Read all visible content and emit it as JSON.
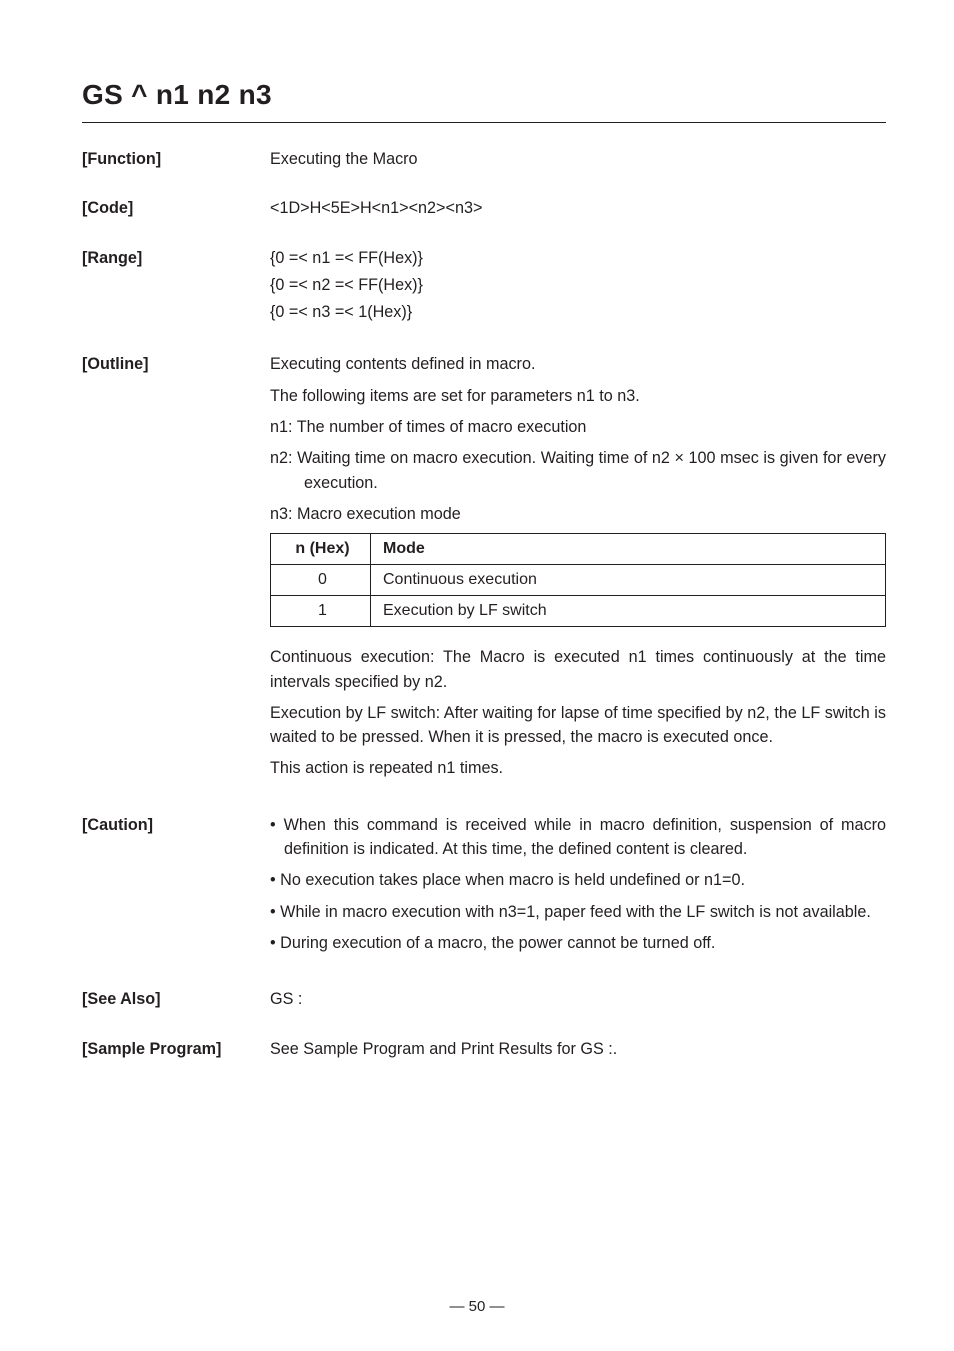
{
  "title": "GS ^ n1 n2 n3",
  "sections": {
    "function": {
      "label": "[Function]",
      "text": "Executing the Macro"
    },
    "code": {
      "label": "[Code]",
      "text": "<1D>H<5E>H<n1><n2><n3>"
    },
    "range": {
      "label": "[Range]",
      "lines": [
        "{0 =< n1 =< FF(Hex)}",
        "{0 =< n2 =< FF(Hex)}",
        "{0 =< n3 =< 1(Hex)}"
      ]
    },
    "outline": {
      "label": "[Outline]",
      "lines": [
        "Executing contents defined in macro.",
        "The following items are set for parameters n1 to n3.",
        "n1:  The number of times of macro execution",
        "n2:  Waiting time on macro execution.  Waiting time of n2 × 100 msec is given for every execution.",
        "n3:  Macro execution mode"
      ],
      "table": {
        "headers": [
          "n (Hex)",
          "Mode"
        ],
        "rows": [
          [
            "0",
            "Continuous execution"
          ],
          [
            "1",
            "Execution by LF switch"
          ]
        ]
      },
      "after": [
        "Continuous execution: The Macro is executed n1 times continuously at the time intervals specified by n2.",
        "Execution by LF switch: After waiting for lapse of time specified by n2, the LF switch is waited to be pressed.  When it is pressed, the macro is executed once.",
        "This action is repeated n1 times."
      ]
    },
    "caution": {
      "label": "[Caution]",
      "bullets": [
        "• When this command is received while in macro definition, suspension of macro definition is indicated.  At this time, the defined content is cleared.",
        "• No execution takes place when macro is held undefined or n1=0.",
        "• While in macro execution with n3=1, paper feed with the LF switch is not available.",
        "• During execution of a macro, the power cannot be turned off."
      ]
    },
    "seealso": {
      "label": "[See Also]",
      "text": "GS :"
    },
    "sample": {
      "label": "[Sample Program]",
      "text": "See Sample Program and Print Results for GS :."
    }
  },
  "footer": "— 50 —"
}
